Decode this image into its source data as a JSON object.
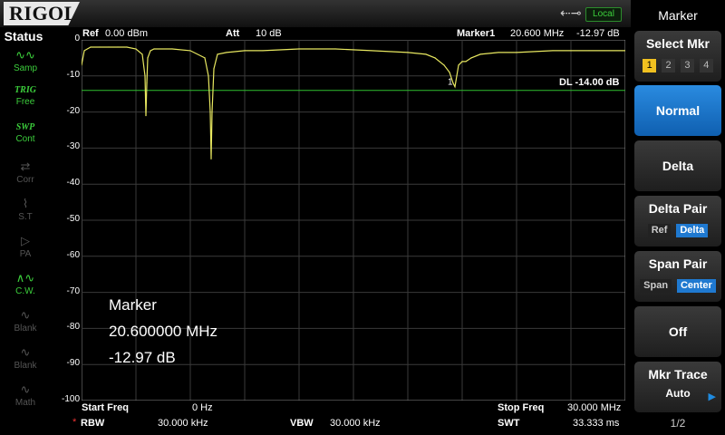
{
  "brand": "RIGOL",
  "top": {
    "usb_icon": "usb-icon",
    "local": "Local"
  },
  "status": {
    "title": "Status",
    "items": [
      {
        "top": "",
        "label": "Samp",
        "icon": "sine-icon",
        "active": true
      },
      {
        "top": "TRIG",
        "label": "Free",
        "icon": "",
        "active": true
      },
      {
        "top": "SWP",
        "label": "Cont",
        "icon": "",
        "active": true
      },
      {
        "top": "",
        "label": "Corr",
        "icon": "corr-icon",
        "active": false
      },
      {
        "top": "",
        "label": "S.T",
        "icon": "st-icon",
        "active": false
      },
      {
        "top": "",
        "label": "PA",
        "icon": "pa-icon",
        "active": false
      },
      {
        "top": "",
        "label": "C.W.",
        "icon": "cw-icon",
        "active": true
      },
      {
        "top": "",
        "label": "Blank",
        "icon": "blank-icon",
        "active": false
      },
      {
        "top": "",
        "label": "Blank",
        "icon": "blank-icon",
        "active": false
      },
      {
        "top": "",
        "label": "Math",
        "icon": "math-icon",
        "active": false
      }
    ]
  },
  "header": {
    "ref_label": "Ref",
    "ref_value": "0.00 dBm",
    "att_label": "Att",
    "att_value": "10 dB",
    "marker_label": "Marker1",
    "marker_freq": "20.600 MHz",
    "marker_level": "-12.97 dB"
  },
  "display_line": "DL -14.00 dB",
  "marker_number": "1",
  "y_ticks": [
    "0",
    "-10",
    "-20",
    "-30",
    "-40",
    "-50",
    "-60",
    "-70",
    "-80",
    "-90",
    "-100"
  ],
  "marker_readout": {
    "title": "Marker",
    "freq": "20.600000 MHz",
    "level": "-12.97 dB"
  },
  "footer": {
    "start_label": "Start Freq",
    "start_value": "0 Hz",
    "stop_label": "Stop Freq",
    "stop_value": "30.000 MHz",
    "rbw_label": "RBW",
    "rbw_value": "30.000 kHz",
    "vbw_label": "VBW",
    "vbw_value": "30.000 kHz",
    "swt_label": "SWT",
    "swt_value": "33.333 ms"
  },
  "panel": {
    "title": "Marker",
    "select_mkr": {
      "label": "Select Mkr",
      "options": [
        "1",
        "2",
        "3",
        "4"
      ],
      "selected": "1"
    },
    "normal": "Normal",
    "delta": "Delta",
    "delta_pair": {
      "label": "Delta Pair",
      "opt1": "Ref",
      "opt2": "Delta"
    },
    "span_pair": {
      "label": "Span Pair",
      "opt1": "Span",
      "opt2": "Center"
    },
    "off": "Off",
    "mkr_trace": {
      "label": "Mkr Trace",
      "value": "Auto"
    },
    "page": "1/2"
  },
  "colors": {
    "trace": "#e8e860",
    "display_line": "#2fbf2f",
    "grid": "#3a3a3a",
    "selected_key": "#1f79d0",
    "marker_select": "#f0c020"
  },
  "chart_data": {
    "type": "line",
    "xlabel": "",
    "ylabel": "",
    "xlim": [
      0,
      30
    ],
    "ylim": [
      -100,
      0
    ],
    "x": [
      0,
      0.15,
      0.5,
      1,
      1.5,
      2,
      2.5,
      3,
      3.35,
      3.5,
      3.55,
      3.6,
      3.65,
      3.8,
      4,
      5,
      6,
      6.8,
      7,
      7.1,
      7.15,
      7.2,
      7.3,
      7.5,
      8,
      9,
      10,
      12,
      14,
      16,
      18,
      19,
      19.5,
      20,
      20.3,
      20.5,
      20.6,
      20.7,
      20.8,
      21,
      21.2,
      21.5,
      22,
      23,
      24,
      26,
      28,
      30
    ],
    "y": [
      -7,
      -3,
      -2,
      -2,
      -2,
      -2,
      -2,
      -2.5,
      -4,
      -10,
      -21,
      -12,
      -5,
      -3,
      -2.5,
      -2.5,
      -3,
      -5,
      -10,
      -20,
      -33,
      -20,
      -8,
      -4,
      -3.5,
      -3,
      -3,
      -2.5,
      -2.5,
      -3,
      -3.5,
      -4,
      -5,
      -7,
      -9,
      -12,
      -13,
      -10,
      -7,
      -6,
      -6,
      -5,
      -4,
      -3.5,
      -3.5,
      -3,
      -3,
      -3
    ]
  }
}
